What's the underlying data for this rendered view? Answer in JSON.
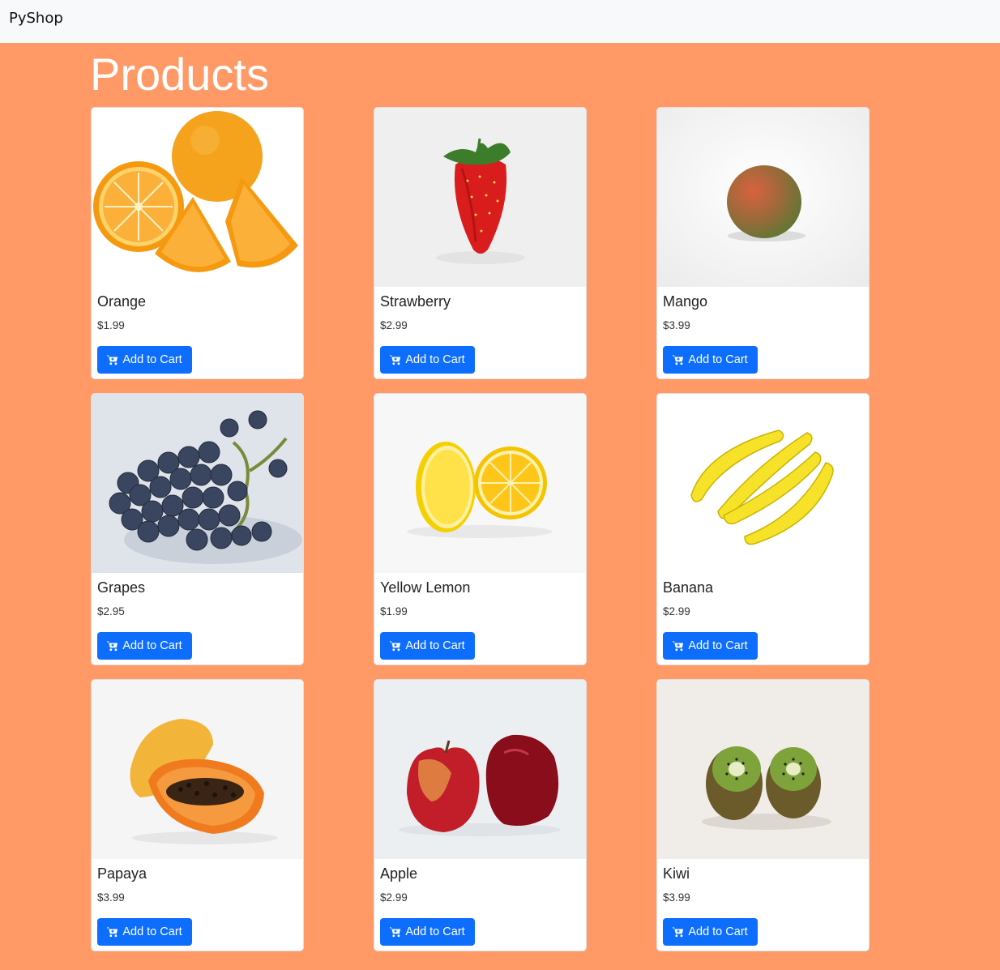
{
  "navbar": {
    "brand": "PyShop"
  },
  "page": {
    "title": "Products"
  },
  "cart_icon": "cart-plus-icon",
  "products": [
    {
      "name": "Orange",
      "price": "$1.99",
      "button": "Add to Cart",
      "image": "orange-image"
    },
    {
      "name": "Strawberry",
      "price": "$2.99",
      "button": "Add to Cart",
      "image": "strawberry-image"
    },
    {
      "name": "Mango",
      "price": "$3.99",
      "button": "Add to Cart",
      "image": "mango-image"
    },
    {
      "name": "Grapes",
      "price": "$2.95",
      "button": "Add to Cart",
      "image": "grapes-image"
    },
    {
      "name": "Yellow Lemon",
      "price": "$1.99",
      "button": "Add to Cart",
      "image": "lemon-image"
    },
    {
      "name": "Banana",
      "price": "$2.99",
      "button": "Add to Cart",
      "image": "banana-image"
    },
    {
      "name": "Papaya",
      "price": "$3.99",
      "button": "Add to Cart",
      "image": "papaya-image"
    },
    {
      "name": "Apple",
      "price": "$2.99",
      "button": "Add to Cart",
      "image": "apple-image"
    },
    {
      "name": "Kiwi",
      "price": "$3.99",
      "button": "Add to Cart",
      "image": "kiwi-image"
    }
  ],
  "colors": {
    "background": "#ff9966",
    "navbar": "#f8f9fa",
    "button": "#0d6efd"
  }
}
